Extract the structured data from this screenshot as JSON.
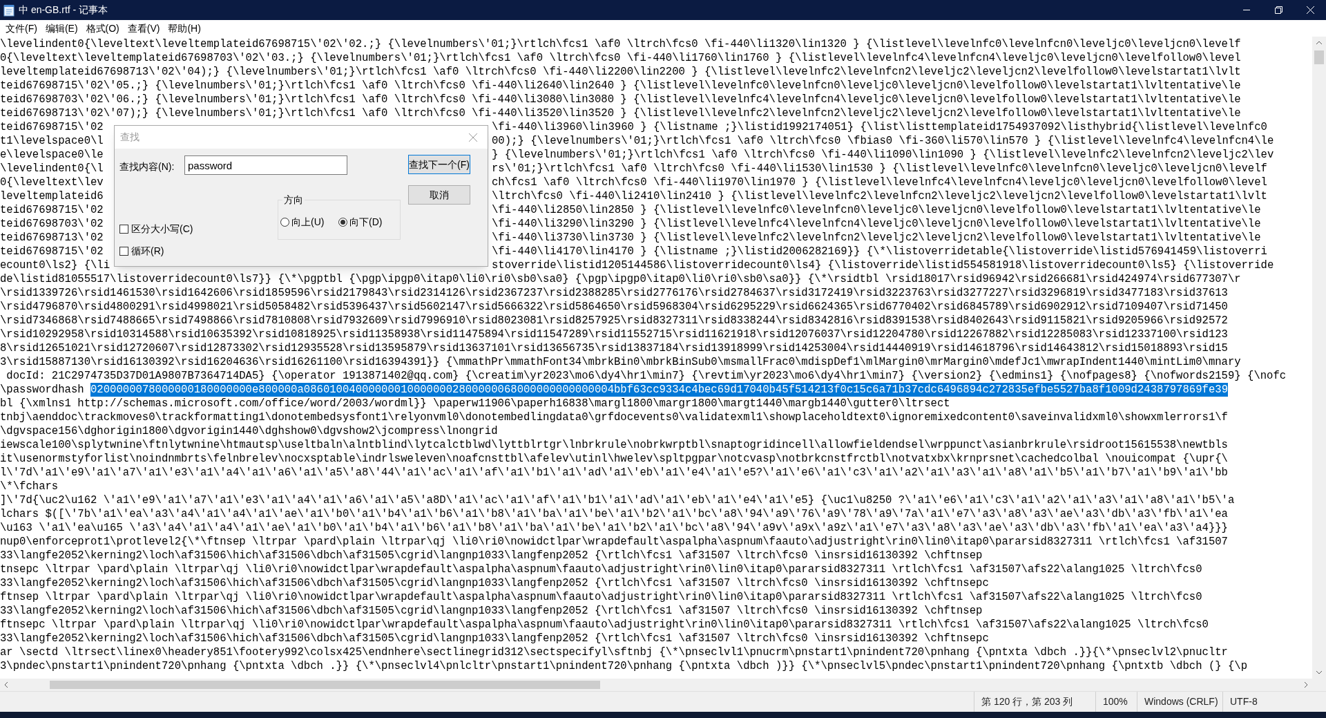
{
  "window": {
    "title": "中 en-GB.rtf - 记事本"
  },
  "menu": [
    "文件(F)",
    "编辑(E)",
    "格式(O)",
    "查看(V)",
    "帮助(H)"
  ],
  "lines": [
    {
      "text": "\\levelindent0{\\leveltext\\leveltemplateid67698715\\'02\\'02.;} {\\levelnumbers\\'01;}\\rtlch\\fcs1 \\af0 \\ltrch\\fcs0 \\fi-440\\li1320\\lin1320 } {\\listlevel\\levelnfc0\\levelnfcn0\\leveljc0\\leveljcn0\\levelf"
    },
    {
      "text": "0{\\leveltext\\leveltemplateid67698703\\'02\\'03.;} {\\levelnumbers\\'01;}\\rtlch\\fcs1 \\af0 \\ltrch\\fcs0 \\fi-440\\li1760\\lin1760 } {\\listlevel\\levelnfc4\\levelnfcn4\\leveljc0\\leveljcn0\\levelfollow0\\level"
    },
    {
      "text": "leveltemplateid67698713\\'02\\'04);} {\\levelnumbers\\'01;}\\rtlch\\fcs1 \\af0 \\ltrch\\fcs0 \\fi-440\\li2200\\lin2200 } {\\listlevel\\levelnfc2\\levelnfcn2\\leveljc2\\leveljcn2\\levelfollow0\\levelstartat1\\lvlt"
    },
    {
      "text": "teid67698715\\'02\\'05.;} {\\levelnumbers\\'01;}\\rtlch\\fcs1 \\af0 \\ltrch\\fcs0 \\fi-440\\li2640\\lin2640 } {\\listlevel\\levelnfc0\\levelnfcn0\\leveljc0\\leveljcn0\\levelfollow0\\levelstartat1\\lvltentative\\le"
    },
    {
      "text": "teid67698703\\'02\\'06.;} {\\levelnumbers\\'01;}\\rtlch\\fcs1 \\af0 \\ltrch\\fcs0 \\fi-440\\li3080\\lin3080 } {\\listlevel\\levelnfc4\\levelnfcn4\\leveljc0\\leveljcn0\\levelfollow0\\levelstartat1\\lvltentative\\le"
    },
    {
      "text": "teid67698713\\'02\\'07);} {\\levelnumbers\\'01;}\\rtlch\\fcs1 \\af0 \\ltrch\\fcs0 \\fi-440\\li3520\\lin3520 } {\\listlevel\\levelnfc2\\levelnfcn2\\leveljc2\\leveljcn2\\levelfollow0\\levelstartat1\\lvltentative\\le"
    },
    {
      "left": "teid67698715\\'02",
      "right": "\\fi-440\\li3960\\lin3960 } {\\listname ;}\\listid1992174051} {\\list\\listtemplateid1754937092\\listhybrid{\\listlevel\\levelnfc0"
    },
    {
      "left": "t1\\levelspace0\\l",
      "right": "00);} {\\levelnumbers\\'01;}\\rtlch\\fcs1 \\af0 \\ltrch\\fcs0 \\fbias0 \\fi-360\\li570\\lin570 } {\\listlevel\\levelnfc4\\levelnfcn4\\le"
    },
    {
      "left": "e\\levelspace0\\le",
      "right": "} {\\levelnumbers\\'01;}\\rtlch\\fcs1 \\af0 \\ltrch\\fcs0 \\fi-440\\li1090\\lin1090 } {\\listlevel\\levelnfc2\\levelnfcn2\\leveljc2\\lev"
    },
    {
      "left": "\\levelindent0{\\l",
      "right": "rs\\'01;}\\rtlch\\fcs1 \\af0 \\ltrch\\fcs0 \\fi-440\\li1530\\lin1530 } {\\listlevel\\levelnfc0\\levelnfcn0\\leveljc0\\leveljcn0\\levelf"
    },
    {
      "left": "0{\\leveltext\\lev",
      "right": "ch\\fcs1 \\af0 \\ltrch\\fcs0 \\fi-440\\li1970\\lin1970 } {\\listlevel\\levelnfc4\\levelnfcn4\\leveljc0\\leveljcn0\\levelfollow0\\level"
    },
    {
      "left": "leveltemplateid6",
      "right": "\\ltrch\\fcs0 \\fi-440\\li2410\\lin2410 } {\\listlevel\\levelnfc2\\levelnfcn2\\leveljc2\\leveljcn2\\levelfollow0\\levelstartat1\\lvlt"
    },
    {
      "left": "teid67698715\\'02",
      "right": "\\fi-440\\li2850\\lin2850 } {\\listlevel\\levelnfc0\\levelnfcn0\\leveljc0\\leveljcn0\\levelfollow0\\levelstartat1\\lvltentative\\le"
    },
    {
      "left": "teid67698703\\'02",
      "right": "\\fi-440\\li3290\\lin3290 } {\\listlevel\\levelnfc4\\levelnfcn4\\leveljc0\\leveljcn0\\levelfollow0\\levelstartat1\\lvltentative\\le"
    },
    {
      "left": "teid67698713\\'02",
      "right": "\\fi-440\\li3730\\lin3730 } {\\listlevel\\levelnfc2\\levelnfcn2\\leveljc2\\leveljcn2\\levelfollow0\\levelstartat1\\lvltentative\\le"
    },
    {
      "left": "teid67698715\\'02",
      "right": "\\fi-440\\li4170\\lin4170 } {\\listname ;}\\listid2006282169}} {\\*\\listoverridetable{\\listoverride\\listid576941459\\listoverri"
    },
    {
      "left": "ecount0\\ls2} {\\li",
      "right": "stoverride\\listid1205144586\\listoverridecount0\\ls4} {\\listoverride\\listid554581918\\listoverridecount0\\ls5} {\\listoverride"
    },
    {
      "text": "de\\listid81055517\\listoverridecount0\\ls7}} {\\*\\pgptbl {\\pgp\\ipgp0\\itap0\\li0\\ri0\\sb0\\sa0} {\\pgp\\ipgp0\\itap0\\li0\\ri0\\sb0\\sa0}} {\\*\\rsidtbl \\rsid18017\\rsid96942\\rsid266681\\rsid424974\\rsid677307\\r"
    },
    {
      "text": "\\rsid1339726\\rsid1461530\\rsid1642606\\rsid1859596\\rsid2179843\\rsid2314126\\rsid2367237\\rsid2388285\\rsid2776176\\rsid2784637\\rsid3172419\\rsid3223763\\rsid3277227\\rsid3296819\\rsid3477183\\rsid37613"
    },
    {
      "text": "\\rsid4796870\\rsid4800291\\rsid4998021\\rsid5058482\\rsid5396437\\rsid5602147\\rsid5666322\\rsid5864650\\rsid5968304\\rsid6295229\\rsid6624365\\rsid6770402\\rsid6845789\\rsid6902912\\rsid7109407\\rsid71450"
    },
    {
      "text": "\\rsid7346868\\rsid7488665\\rsid7498866\\rsid7810808\\rsid7932609\\rsid7996910\\rsid8023081\\rsid8257925\\rsid8327311\\rsid8338244\\rsid8342816\\rsid8391538\\rsid8402643\\rsid9115821\\rsid9205966\\rsid92572"
    },
    {
      "text": "\\rsid10292958\\rsid10314588\\rsid10635392\\rsid10818925\\rsid11358938\\rsid11475894\\rsid11547289\\rsid11552715\\rsid11621918\\rsid12076037\\rsid12204780\\rsid12267882\\rsid12285083\\rsid12337100\\rsid123"
    },
    {
      "text": "8\\rsid12651021\\rsid12720607\\rsid12873302\\rsid12935528\\rsid13595879\\rsid13637101\\rsid13656735\\rsid13837184\\rsid13918999\\rsid14253004\\rsid14440919\\rsid14618796\\rsid14643812\\rsid15018893\\rsid15"
    },
    {
      "text": "3\\rsid15887130\\rsid16130392\\rsid16204636\\rsid16261100\\rsid16394391}} {\\mmathPr\\mmathFont34\\mbrkBin0\\mbrkBinSub0\\msmallFrac0\\mdispDef1\\mlMargin0\\mrMargin0\\mdefJc1\\mwrapIndent1440\\mintLim0\\mnary"
    },
    {
      "text": " docId: 21C2974735D37D01A9807B7364714DA5} {\\operator 1913871402@qq.com} {\\creatim\\yr2023\\mo6\\dy4\\hr1\\min7} {\\revtim\\yr2023\\mo6\\dy4\\hr1\\min7} {\\version2} {\\edmins1} {\\nofpages8} {\\nofwords2159} {\\nofc"
    },
    {
      "text": "\\passwordhash ",
      "highlight": "0200000078000000180000000e800000a086010040000000100000002800000068000000000000004bbf63cc9334c4bec69d17040b45f514213f0c15c6a71b37cdc6496894c272835efbe5527ba8f1009d2438797869fe39"
    },
    {
      "text": "bl {\\xmlns1 http://schemas.microsoft.com/office/word/2003/wordml}} \\paperw11906\\paperh16838\\margl1800\\margr1800\\margt1440\\margb1440\\gutter0\\ltrsect"
    },
    {
      "text": "tnbj\\aenddoc\\trackmoves0\\trackformatting1\\donotembedsysfont1\\relyonvml0\\donotembedlingdata0\\grfdocevents0\\validatexml1\\showplaceholdtext0\\ignoremixedcontent0\\saveinvalidxml0\\showxmlerrors1\\f"
    },
    {
      "text": "\\dgvspace156\\dghorigin1800\\dgvorigin1440\\dghshow0\\dgvshow2\\jcompress\\lnongrid"
    },
    {
      "text": "iewscale100\\splytwnine\\ftnlytwnine\\htmautsp\\useltbaln\\alntblind\\lytcalctblwd\\lyttblrtgr\\lnbrkrule\\nobrkwrptbl\\snaptogridincell\\allowfieldendsel\\wrppunct\\asianbrkrule\\rsidroot15615538\\newtbls"
    },
    {
      "text": "it\\usenormstyforlist\\noindnmbrts\\felnbrelev\\nocxsptable\\indrlsweleven\\noafcnsttbl\\afelev\\utinl\\hwelev\\spltpgpar\\notcvasp\\notbrkcnstfrctbl\\notvatxbx\\krnprsnet\\cachedcolbal \\nouicompat {\\upr{\\"
    },
    {
      "text": "l\\'7d\\'a1\\'e9\\'a1\\'a7\\'a1\\'e3\\'a1\\'a4\\'a1\\'a6\\'a1\\'a5\\'a8\\'44\\'a1\\'ac\\'a1\\'af\\'a1\\'b1\\'a1\\'ad\\'a1\\'eb\\'a1\\'e4\\'a1\\'e5?\\'a1\\'e6\\'a1\\'c3\\'a1\\'a2\\'a1\\'a3\\'a1\\'a8\\'a1\\'b5\\'a1\\'b7\\'a1\\'b9\\'a1\\'bb"
    },
    {
      "text": "\\*\\fchars"
    },
    {
      "text": "]\\'7d{\\uc2\\u162 \\'a1\\'e9\\'a1\\'a7\\'a1\\'e3\\'a1\\'a4\\'a1\\'a6\\'a1\\'a5\\'a8D\\'a1\\'ac\\'a1\\'af\\'a1\\'b1\\'a1\\'ad\\'a1\\'eb\\'a1\\'e4\\'a1\\'e5} {\\uc1\\u8250 ?\\'a1\\'e6\\'a1\\'c3\\'a1\\'a2\\'a1\\'a3\\'a1\\'a8\\'a1\\'b5\\'a"
    },
    {
      "text": "lchars $([\\'7b\\'a1\\'ea\\'a3\\'a4\\'a1\\'a4\\'a1\\'ae\\'a1\\'b0\\'a1\\'b4\\'a1\\'b6\\'a1\\'b8\\'a1\\'ba\\'a1\\'be\\'a1\\'b2\\'a1\\'bc\\'a8\\'94\\'a9\\'76\\'a9\\'78\\'a9\\'7a\\'a1\\'e7\\'a3\\'a8\\'a3\\'ae\\'a3\\'db\\'a3\\'fb\\'a1\\'ea"
    },
    {
      "text": "\\u163 \\'a1\\'ea\\u165 \\'a3\\'a4\\'a1\\'a4\\'a1\\'ae\\'a1\\'b0\\'a1\\'b4\\'a1\\'b6\\'a1\\'b8\\'a1\\'ba\\'a1\\'be\\'a1\\'b2\\'a1\\'bc\\'a8\\'94\\'a9v\\'a9x\\'a9z\\'a1\\'e7\\'a3\\'a8\\'a3\\'ae\\'a3\\'db\\'a3\\'fb\\'a1\\'ea\\'a3\\'a4}}}"
    },
    {
      "text": "nup0\\enforceprot1\\protlevel2{\\*\\ftnsep \\ltrpar \\pard\\plain \\ltrpar\\qj \\li0\\ri0\\nowidctlpar\\wrapdefault\\aspalpha\\aspnum\\faauto\\adjustright\\rin0\\lin0\\itap0\\pararsid8327311 \\rtlch\\fcs1 \\af31507"
    },
    {
      "text": "33\\langfe2052\\kerning2\\loch\\af31506\\hich\\af31506\\dbch\\af31505\\cgrid\\langnp1033\\langfenp2052 {\\rtlch\\fcs1 \\af31507 \\ltrch\\fcs0 \\insrsid16130392 \\chftnsep"
    },
    {
      "text": "tnsepc \\ltrpar \\pard\\plain \\ltrpar\\qj \\li0\\ri0\\nowidctlpar\\wrapdefault\\aspalpha\\aspnum\\faauto\\adjustright\\rin0\\lin0\\itap0\\pararsid8327311 \\rtlch\\fcs1 \\af31507\\afs22\\alang1025 \\ltrch\\fcs0"
    },
    {
      "text": "33\\langfe2052\\kerning2\\loch\\af31506\\hich\\af31506\\dbch\\af31505\\cgrid\\langnp1033\\langfenp2052 {\\rtlch\\fcs1 \\af31507 \\ltrch\\fcs0 \\insrsid16130392 \\chftnsepc"
    },
    {
      "text": "ftnsep \\ltrpar \\pard\\plain \\ltrpar\\qj \\li0\\ri0\\nowidctlpar\\wrapdefault\\aspalpha\\aspnum\\faauto\\adjustright\\rin0\\lin0\\itap0\\pararsid8327311 \\rtlch\\fcs1 \\af31507\\afs22\\alang1025 \\ltrch\\fcs0"
    },
    {
      "text": "33\\langfe2052\\kerning2\\loch\\af31506\\hich\\af31506\\dbch\\af31505\\cgrid\\langnp1033\\langfenp2052 {\\rtlch\\fcs1 \\af31507 \\ltrch\\fcs0 \\insrsid16130392 \\chftnsep"
    },
    {
      "text": "ftnsepc \\ltrpar \\pard\\plain \\ltrpar\\qj \\li0\\ri0\\nowidctlpar\\wrapdefault\\aspalpha\\aspnum\\faauto\\adjustright\\rin0\\lin0\\itap0\\pararsid8327311 \\rtlch\\fcs1 \\af31507\\afs22\\alang1025 \\ltrch\\fcs0"
    },
    {
      "text": "33\\langfe2052\\kerning2\\loch\\af31506\\hich\\af31506\\dbch\\af31505\\cgrid\\langnp1033\\langfenp2052 {\\rtlch\\fcs1 \\af31507 \\ltrch\\fcs0 \\insrsid16130392 \\chftnsepc"
    },
    {
      "text": "ar \\sectd \\ltrsect\\linex0\\headery851\\footery992\\colsx425\\endnhere\\sectlinegrid312\\sectspecifyl\\sftnbj {\\*\\pnseclvl1\\pnucrm\\pnstart1\\pnindent720\\pnhang {\\pntxta \\dbch .}}{\\*\\pnseclvl2\\pnucltr"
    },
    {
      "text": "3\\pndec\\pnstart1\\pnindent720\\pnhang {\\pntxta \\dbch .}} {\\*\\pnseclvl4\\pnlcltr\\pnstart1\\pnindent720\\pnhang {\\pntxta \\dbch )}} {\\*\\pnseclvl5\\pndec\\pnstart1\\pnindent720\\pnhang {\\pntxtb \\dbch (} {\\p"
    }
  ],
  "find_dialog": {
    "title": "查找",
    "find_label": "查找内容(N):",
    "find_value": "password",
    "find_next_button": "查找下一个(F)",
    "cancel_button": "取消",
    "direction": {
      "label": "方向",
      "options": [
        {
          "label": "向上(U)",
          "selected": false
        },
        {
          "label": "向下(D)",
          "selected": true
        }
      ]
    },
    "options": [
      {
        "label": "区分大小写(C)",
        "checked": false
      },
      {
        "label": "循环(R)",
        "checked": false
      }
    ]
  },
  "status_bar": [
    "第 120 行，第 203 列",
    "100%",
    "Windows (CRLF)",
    "UTF-8"
  ]
}
